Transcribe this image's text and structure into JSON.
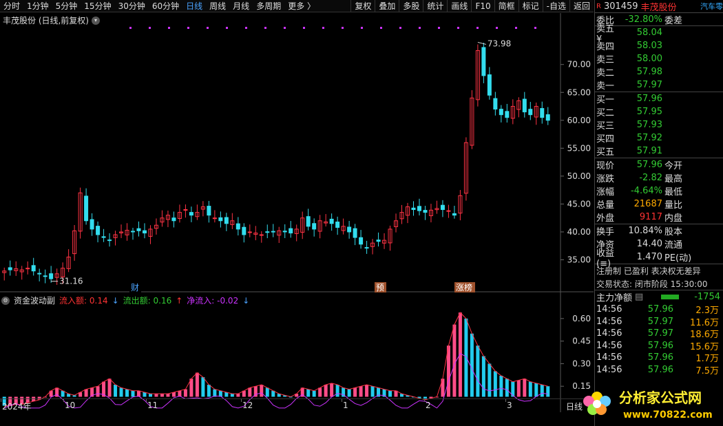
{
  "toolbar": {
    "periods": [
      "分时",
      "1分钟",
      "5分钟",
      "15分钟",
      "30分钟",
      "60分钟",
      "日线",
      "周线",
      "月线",
      "多周期",
      "更多 〉"
    ],
    "active_period": "日线",
    "tools": [
      "复权",
      "叠加",
      "多股",
      "统计",
      "画线",
      "F10",
      "简框",
      "标记",
      "-自选",
      "返回"
    ]
  },
  "chart": {
    "title": "丰茂股份 (日线,前复权)",
    "high_label": "73.98",
    "low_label": "31.16",
    "y_ticks": [
      "70.00",
      "65.00",
      "60.00",
      "55.00",
      "50.00",
      "45.00",
      "40.00",
      "35.00"
    ],
    "markers": [
      "财",
      "预",
      "涨榜"
    ]
  },
  "indicator": {
    "name": "资金波动副",
    "inflow_label": "流入额: 0.14",
    "outflow_label": "流出额: 0.16",
    "net_label": "净流入: -0.02",
    "y_ticks": [
      "0.60",
      "0.45",
      "0.30",
      "0.15"
    ]
  },
  "x_axis": {
    "labels": [
      "2024年",
      "10",
      "11",
      "12",
      "1",
      "2",
      "3"
    ],
    "right_label": "日线"
  },
  "colors": {
    "up": "#ff3344",
    "down": "#33ddee",
    "accent": "#4aa3ff",
    "purple": "#cc33ff"
  },
  "chart_data": {
    "type": "line",
    "title": "丰茂股份 (日线,前复权)",
    "series": [
      {
        "name": "close",
        "values": [
          33.0,
          33.2,
          33.4,
          33.2,
          33.5,
          33.0,
          32.5,
          32.0,
          31.6,
          32.5,
          33.5,
          35.5,
          40.2,
          47.0,
          42.0,
          40.5,
          39.5,
          39.0,
          38.5,
          39.5,
          40.0,
          40.3,
          40.0,
          40.2,
          39.8,
          40.5,
          41.2,
          42.5,
          43.0,
          42.0,
          43.5,
          44.0,
          43.0,
          43.5,
          44.5,
          43.0,
          42.5,
          42.0,
          41.5,
          42.0,
          40.5,
          39.5,
          40.0,
          39.8,
          39.5,
          39.9,
          40.0,
          40.2,
          40.0,
          39.8,
          40.5,
          42.5,
          41.0,
          40.5,
          42.0,
          41.8,
          41.5,
          40.8,
          41.0,
          40.0,
          39.0,
          37.8,
          37.2,
          38.0,
          38.3,
          38.5,
          40.5,
          42.0,
          43.5,
          44.5,
          44.0,
          43.8,
          43.5,
          43.9,
          44.2,
          44.0,
          43.8,
          43.0,
          46.5,
          56.0,
          64.0,
          72.5,
          68.0,
          64.5,
          62.0,
          61.0,
          60.5,
          62.5,
          63.5,
          61.5,
          61.0,
          62.5,
          60.5,
          60.0
        ]
      }
    ],
    "indicator_values": [
      0.02,
      0.02,
      0.03,
      0.03,
      0.04,
      0.05,
      0.06,
      0.08,
      0.12,
      0.14,
      0.12,
      0.1,
      0.09,
      0.11,
      0.13,
      0.14,
      0.15,
      0.18,
      0.2,
      0.16,
      0.14,
      0.13,
      0.12,
      0.12,
      0.11,
      0.1,
      0.1,
      0.1,
      0.1,
      0.11,
      0.12,
      0.13,
      0.2,
      0.24,
      0.21,
      0.16,
      0.13,
      0.12,
      0.11,
      0.1,
      0.1,
      0.12,
      0.14,
      0.15,
      0.16,
      0.14,
      0.12,
      0.1,
      0.09,
      0.08,
      0.1,
      0.14,
      0.13,
      0.12,
      0.14,
      0.16,
      0.17,
      0.16,
      0.14,
      0.13,
      0.14,
      0.15,
      0.16,
      0.15,
      0.14,
      0.13,
      0.12,
      0.12,
      0.1,
      0.09,
      0.08,
      0.07,
      0.06,
      0.07,
      0.08,
      0.2,
      0.42,
      0.56,
      0.64,
      0.6,
      0.5,
      0.42,
      0.35,
      0.3,
      0.25,
      0.22,
      0.2,
      0.18,
      0.19,
      0.2,
      0.18,
      0.17,
      0.16,
      0.15
    ],
    "ylim": [
      31.16,
      73.98
    ]
  },
  "quote": {
    "badge": "R",
    "code": "301459",
    "name": "丰茂股份",
    "industry": "汽车零",
    "weibi_label": "委比",
    "weibi": "-32.80%",
    "weicha_label": "委差",
    "sells": [
      {
        "l": "卖五 ¥",
        "v": "58.04"
      },
      {
        "l": "卖四",
        "v": "58.03"
      },
      {
        "l": "卖三",
        "v": "58.00"
      },
      {
        "l": "卖二",
        "v": "57.98"
      },
      {
        "l": "卖一",
        "v": "57.97"
      }
    ],
    "buys": [
      {
        "l": "买一",
        "v": "57.96"
      },
      {
        "l": "买二",
        "v": "57.95"
      },
      {
        "l": "买三",
        "v": "57.93"
      },
      {
        "l": "买四",
        "v": "57.92"
      },
      {
        "l": "买五",
        "v": "57.91"
      }
    ],
    "stats": [
      {
        "l": "现价",
        "v": "57.96",
        "c": "green",
        "l2": "今开"
      },
      {
        "l": "涨跌",
        "v": "-2.82",
        "c": "green",
        "l2": "最高"
      },
      {
        "l": "涨幅",
        "v": "-4.64%",
        "c": "green",
        "l2": "最低"
      },
      {
        "l": "总量",
        "v": "21687",
        "c": "orange",
        "l2": "量比"
      },
      {
        "l": "外盘",
        "v": "9117",
        "c": "red",
        "l2": "内盘"
      }
    ],
    "stats2": [
      {
        "l": "换手",
        "v": "10.84%",
        "c": "white",
        "l2": "股本"
      },
      {
        "l": "净资",
        "v": "14.40",
        "c": "white",
        "l2": "流通"
      },
      {
        "l": "收益(≡)",
        "v": "1.470",
        "c": "white",
        "l2": "PE(动)"
      }
    ],
    "tags": "注册制 已盈利 表决权无差异",
    "status": "交易状态: 闭市阶段 15:30:00",
    "mainflow_label": "主力净额",
    "mainflow_value": "-1754",
    "ticks": [
      {
        "t": "14:56",
        "p": "57.96",
        "q": "2.3万"
      },
      {
        "t": "14:56",
        "p": "57.97",
        "q": "11.6万"
      },
      {
        "t": "14:56",
        "p": "57.97",
        "q": "18.6万"
      },
      {
        "t": "14:56",
        "p": "57.96",
        "q": "15.6万"
      },
      {
        "t": "14:56",
        "p": "57.96",
        "q": "1.7万"
      },
      {
        "t": "14:56",
        "p": "57.96",
        "q": "7.5万"
      }
    ]
  },
  "logo": {
    "text": "分析家公式网",
    "url": "www.70822.com"
  }
}
